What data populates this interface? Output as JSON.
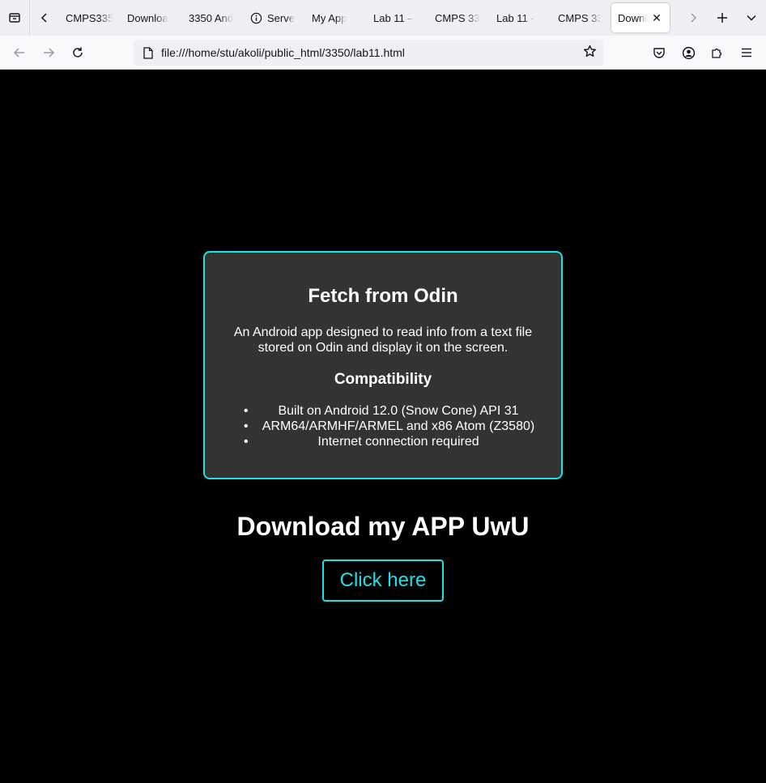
{
  "browser": {
    "tabs": [
      {
        "label": "CMPS335"
      },
      {
        "label": "Downloa"
      },
      {
        "label": "3350 And"
      },
      {
        "label": "Serve",
        "icon": "info-icon"
      },
      {
        "label": "My App"
      },
      {
        "label": "Lab 11 –"
      },
      {
        "label": "CMPS 33"
      },
      {
        "label": "Lab 11 -"
      },
      {
        "label": "CMPS 33"
      },
      {
        "label": "Downl",
        "active": true
      }
    ],
    "url": "file:///home/stu/akoli/public_html/3350/lab11.html"
  },
  "card": {
    "title": "Fetch from Odin",
    "description": "An Android app designed to read info from a text file stored on Odin and display it on the screen.",
    "compat_heading": "Compatibility",
    "items": [
      "Built on Android 12.0 (Snow Cone) API 31",
      "ARM64/ARMHF/ARMEL and x86 Atom (Z3580)",
      "Internet connection required"
    ]
  },
  "download": {
    "title": "Download my APP UwU",
    "button_label": "Click here"
  },
  "colors": {
    "accent": "#19e3e8",
    "card_bg": "#333333",
    "page_bg": "#000000"
  }
}
